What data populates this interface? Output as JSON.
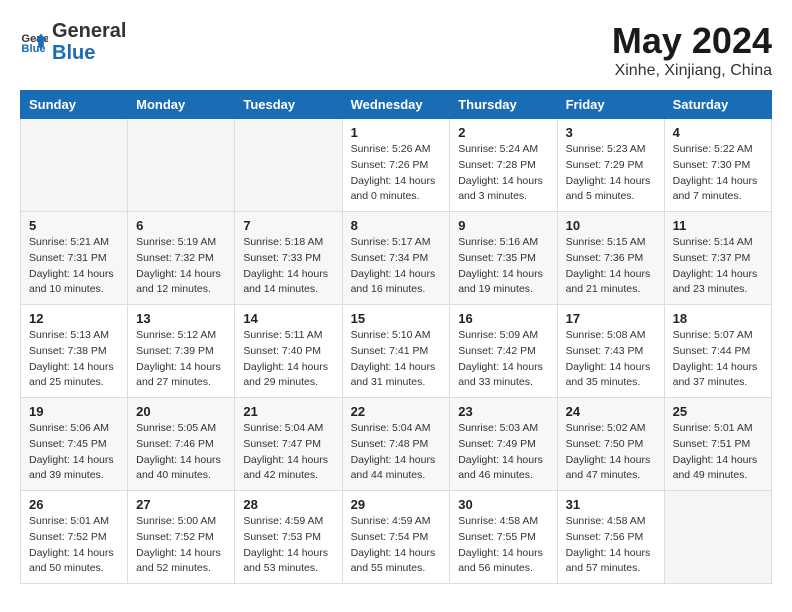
{
  "header": {
    "logo_general": "General",
    "logo_blue": "Blue",
    "title": "May 2024",
    "subtitle": "Xinhe, Xinjiang, China"
  },
  "weekdays": [
    "Sunday",
    "Monday",
    "Tuesday",
    "Wednesday",
    "Thursday",
    "Friday",
    "Saturday"
  ],
  "weeks": [
    [
      {
        "day": "",
        "sunrise": "",
        "sunset": "",
        "daylight": ""
      },
      {
        "day": "",
        "sunrise": "",
        "sunset": "",
        "daylight": ""
      },
      {
        "day": "",
        "sunrise": "",
        "sunset": "",
        "daylight": ""
      },
      {
        "day": "1",
        "sunrise": "Sunrise: 5:26 AM",
        "sunset": "Sunset: 7:26 PM",
        "daylight": "Daylight: 14 hours and 0 minutes."
      },
      {
        "day": "2",
        "sunrise": "Sunrise: 5:24 AM",
        "sunset": "Sunset: 7:28 PM",
        "daylight": "Daylight: 14 hours and 3 minutes."
      },
      {
        "day": "3",
        "sunrise": "Sunrise: 5:23 AM",
        "sunset": "Sunset: 7:29 PM",
        "daylight": "Daylight: 14 hours and 5 minutes."
      },
      {
        "day": "4",
        "sunrise": "Sunrise: 5:22 AM",
        "sunset": "Sunset: 7:30 PM",
        "daylight": "Daylight: 14 hours and 7 minutes."
      }
    ],
    [
      {
        "day": "5",
        "sunrise": "Sunrise: 5:21 AM",
        "sunset": "Sunset: 7:31 PM",
        "daylight": "Daylight: 14 hours and 10 minutes."
      },
      {
        "day": "6",
        "sunrise": "Sunrise: 5:19 AM",
        "sunset": "Sunset: 7:32 PM",
        "daylight": "Daylight: 14 hours and 12 minutes."
      },
      {
        "day": "7",
        "sunrise": "Sunrise: 5:18 AM",
        "sunset": "Sunset: 7:33 PM",
        "daylight": "Daylight: 14 hours and 14 minutes."
      },
      {
        "day": "8",
        "sunrise": "Sunrise: 5:17 AM",
        "sunset": "Sunset: 7:34 PM",
        "daylight": "Daylight: 14 hours and 16 minutes."
      },
      {
        "day": "9",
        "sunrise": "Sunrise: 5:16 AM",
        "sunset": "Sunset: 7:35 PM",
        "daylight": "Daylight: 14 hours and 19 minutes."
      },
      {
        "day": "10",
        "sunrise": "Sunrise: 5:15 AM",
        "sunset": "Sunset: 7:36 PM",
        "daylight": "Daylight: 14 hours and 21 minutes."
      },
      {
        "day": "11",
        "sunrise": "Sunrise: 5:14 AM",
        "sunset": "Sunset: 7:37 PM",
        "daylight": "Daylight: 14 hours and 23 minutes."
      }
    ],
    [
      {
        "day": "12",
        "sunrise": "Sunrise: 5:13 AM",
        "sunset": "Sunset: 7:38 PM",
        "daylight": "Daylight: 14 hours and 25 minutes."
      },
      {
        "day": "13",
        "sunrise": "Sunrise: 5:12 AM",
        "sunset": "Sunset: 7:39 PM",
        "daylight": "Daylight: 14 hours and 27 minutes."
      },
      {
        "day": "14",
        "sunrise": "Sunrise: 5:11 AM",
        "sunset": "Sunset: 7:40 PM",
        "daylight": "Daylight: 14 hours and 29 minutes."
      },
      {
        "day": "15",
        "sunrise": "Sunrise: 5:10 AM",
        "sunset": "Sunset: 7:41 PM",
        "daylight": "Daylight: 14 hours and 31 minutes."
      },
      {
        "day": "16",
        "sunrise": "Sunrise: 5:09 AM",
        "sunset": "Sunset: 7:42 PM",
        "daylight": "Daylight: 14 hours and 33 minutes."
      },
      {
        "day": "17",
        "sunrise": "Sunrise: 5:08 AM",
        "sunset": "Sunset: 7:43 PM",
        "daylight": "Daylight: 14 hours and 35 minutes."
      },
      {
        "day": "18",
        "sunrise": "Sunrise: 5:07 AM",
        "sunset": "Sunset: 7:44 PM",
        "daylight": "Daylight: 14 hours and 37 minutes."
      }
    ],
    [
      {
        "day": "19",
        "sunrise": "Sunrise: 5:06 AM",
        "sunset": "Sunset: 7:45 PM",
        "daylight": "Daylight: 14 hours and 39 minutes."
      },
      {
        "day": "20",
        "sunrise": "Sunrise: 5:05 AM",
        "sunset": "Sunset: 7:46 PM",
        "daylight": "Daylight: 14 hours and 40 minutes."
      },
      {
        "day": "21",
        "sunrise": "Sunrise: 5:04 AM",
        "sunset": "Sunset: 7:47 PM",
        "daylight": "Daylight: 14 hours and 42 minutes."
      },
      {
        "day": "22",
        "sunrise": "Sunrise: 5:04 AM",
        "sunset": "Sunset: 7:48 PM",
        "daylight": "Daylight: 14 hours and 44 minutes."
      },
      {
        "day": "23",
        "sunrise": "Sunrise: 5:03 AM",
        "sunset": "Sunset: 7:49 PM",
        "daylight": "Daylight: 14 hours and 46 minutes."
      },
      {
        "day": "24",
        "sunrise": "Sunrise: 5:02 AM",
        "sunset": "Sunset: 7:50 PM",
        "daylight": "Daylight: 14 hours and 47 minutes."
      },
      {
        "day": "25",
        "sunrise": "Sunrise: 5:01 AM",
        "sunset": "Sunset: 7:51 PM",
        "daylight": "Daylight: 14 hours and 49 minutes."
      }
    ],
    [
      {
        "day": "26",
        "sunrise": "Sunrise: 5:01 AM",
        "sunset": "Sunset: 7:52 PM",
        "daylight": "Daylight: 14 hours and 50 minutes."
      },
      {
        "day": "27",
        "sunrise": "Sunrise: 5:00 AM",
        "sunset": "Sunset: 7:52 PM",
        "daylight": "Daylight: 14 hours and 52 minutes."
      },
      {
        "day": "28",
        "sunrise": "Sunrise: 4:59 AM",
        "sunset": "Sunset: 7:53 PM",
        "daylight": "Daylight: 14 hours and 53 minutes."
      },
      {
        "day": "29",
        "sunrise": "Sunrise: 4:59 AM",
        "sunset": "Sunset: 7:54 PM",
        "daylight": "Daylight: 14 hours and 55 minutes."
      },
      {
        "day": "30",
        "sunrise": "Sunrise: 4:58 AM",
        "sunset": "Sunset: 7:55 PM",
        "daylight": "Daylight: 14 hours and 56 minutes."
      },
      {
        "day": "31",
        "sunrise": "Sunrise: 4:58 AM",
        "sunset": "Sunset: 7:56 PM",
        "daylight": "Daylight: 14 hours and 57 minutes."
      },
      {
        "day": "",
        "sunrise": "",
        "sunset": "",
        "daylight": ""
      }
    ]
  ]
}
